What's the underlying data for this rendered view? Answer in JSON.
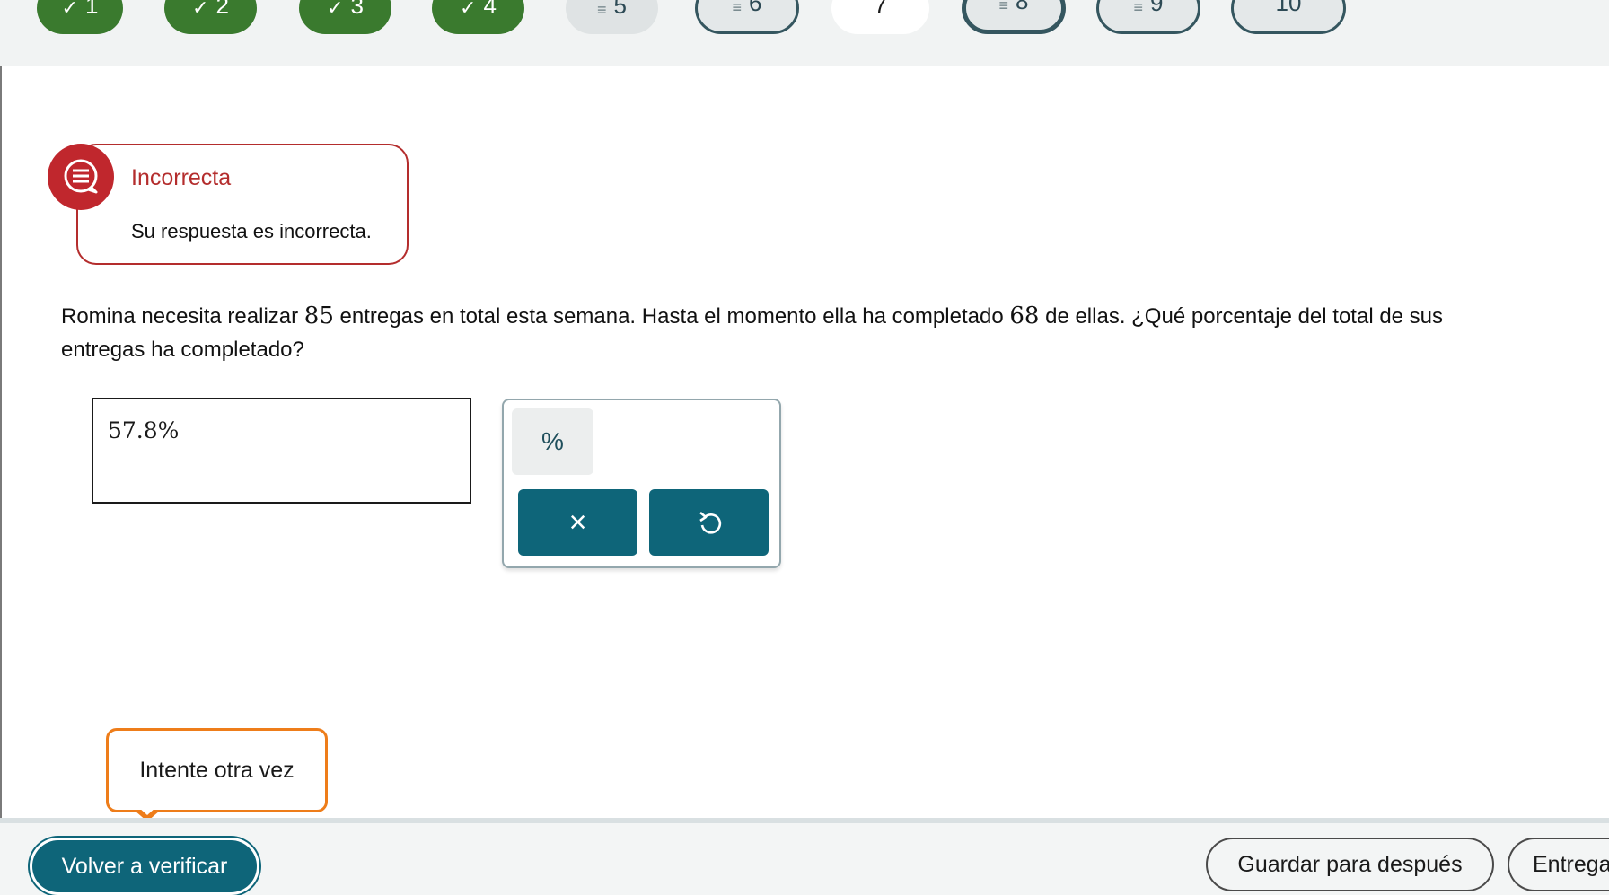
{
  "nav": {
    "questions": [
      {
        "label": "1",
        "state": "done",
        "icon": "✓"
      },
      {
        "label": "2",
        "state": "done",
        "icon": "✓"
      },
      {
        "label": "3",
        "state": "done",
        "icon": "✓"
      },
      {
        "label": "4",
        "state": "done",
        "icon": "✓"
      },
      {
        "label": "5",
        "state": "pending",
        "icon": "≡"
      },
      {
        "label": "6",
        "state": "outlined",
        "icon": "≡"
      },
      {
        "label": "7",
        "state": "current",
        "icon": ""
      },
      {
        "label": "8",
        "state": "outlined-bold",
        "icon": "≡"
      },
      {
        "label": "9",
        "state": "outlined",
        "icon": "≡"
      },
      {
        "label": "10",
        "state": "outlined",
        "icon": ""
      }
    ]
  },
  "feedback": {
    "title": "Incorrecta",
    "message": "Su respuesta es incorrecta.",
    "color": "#b42d2d"
  },
  "question": {
    "part1": "Romina necesita realizar ",
    "total": "85",
    "part2": " entregas en total esta semana. Hasta el momento ella ha completado ",
    "done": "68",
    "part3": " de ellas. ¿Qué porcentaje del total de sus",
    "line2": "entregas ha completado?"
  },
  "answer": {
    "value": "57.8%"
  },
  "keypad": {
    "percent_key": "%",
    "clear_key": "×",
    "undo_key": "↶",
    "accent": "#0e6579"
  },
  "tooltip": {
    "text": "Intente otra vez"
  },
  "footer": {
    "recheck_label": "Volver a verificar",
    "save_label": "Guardar para después",
    "submit_label": "Entrega"
  }
}
